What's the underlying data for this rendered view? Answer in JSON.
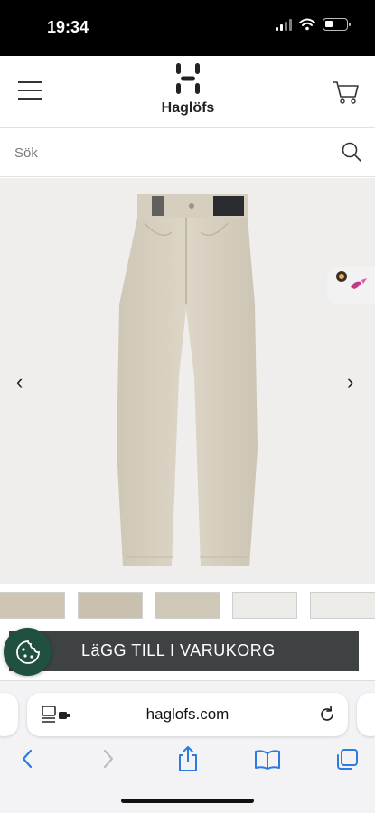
{
  "status_bar": {
    "time": "19:34"
  },
  "header": {
    "brand": "Haglöfs",
    "logo_letter": "H"
  },
  "search": {
    "placeholder": "Sök"
  },
  "product": {
    "add_to_cart_label": "LäGG TILL I VARUKORG"
  },
  "browser": {
    "url": "haglofs.com"
  },
  "colors": {
    "cookie_button": "#1f5040",
    "add_bar": "#3f4243",
    "pants": "#d9d2c2",
    "link_blue": "#2c7be5"
  },
  "icons": [
    "menu-icon",
    "cart-icon",
    "search-icon",
    "chevron-left-icon",
    "chevron-right-icon",
    "cookie-icon",
    "reader-icon",
    "reload-icon",
    "back-icon",
    "forward-icon",
    "share-icon",
    "bookmarks-icon",
    "tabs-icon"
  ]
}
